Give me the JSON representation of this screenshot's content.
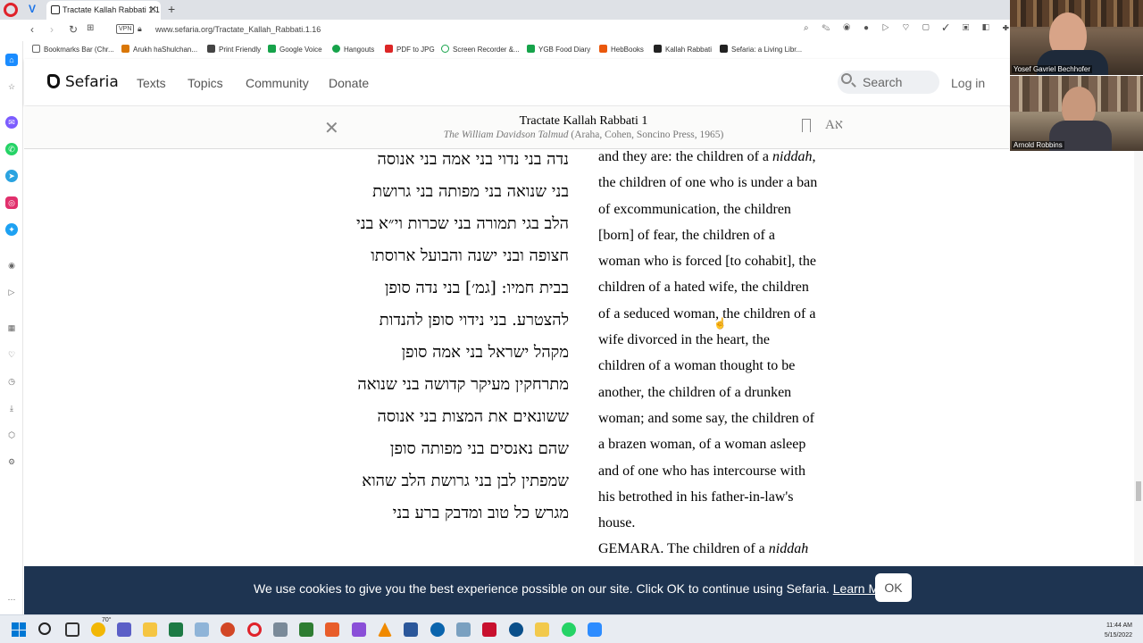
{
  "browser": {
    "tab_title": "Tractate Kallah Rabbati 1:1",
    "url": "www.sefaria.org/Tractate_Kallah_Rabbati.1.16",
    "vpn_label": "VPN",
    "bookmarks": [
      "Bookmarks Bar (Chr...",
      "Arukh haShulchan...",
      "Print Friendly",
      "Google Voice",
      "Hangouts",
      "PDF to JPG",
      "Screen Recorder &...",
      "YGB Food Diary",
      "HebBooks",
      "Kallah Rabbati",
      "Sefaria: a Living Libr..."
    ],
    "bookmark_colors": [
      "#666666",
      "#d97706",
      "#444444",
      "#16a34a",
      "#16a34a",
      "#dc2626",
      "#16a34a",
      "#16a34a",
      "#ea580c",
      "#222222",
      "#222222"
    ]
  },
  "sefaria": {
    "logo": "Sefaria",
    "nav": [
      "Texts",
      "Topics",
      "Community",
      "Donate"
    ],
    "search_placeholder": "Search",
    "login": "Log in"
  },
  "reader": {
    "title": "Tractate Kallah Rabbati 1",
    "subtitle_italic": "The William Davidson Talmud",
    "subtitle_rest": " (Araha, Cohen, Soncino Press, 1965)"
  },
  "hebrew_lines": [
    "נדה בני נדוי בני אמה בני אנוסה",
    "בני שנואה בני מפותה בני גרושת",
    "הלב בגי תמורה בני שכרות וי״א בני",
    "חצופה ובני ישנה והבועל ארוסתו",
    "בבית חמיו: [גמ׳] בני נדה סופן",
    "להצטרע. בני נידוי סופן להנדות",
    "מקהל ישראל בני אמה סופן",
    "מתרחקין מעיקר קדושה בני שנואה",
    "ששונאים את המצות בני אנוסה",
    "שהם נאנסים בני מפותה סופן",
    "שמפתין לבן בני גרושת הלב שהוא",
    "מגרש כל טוב ומדבק ברע בני"
  ],
  "english_lines": [
    "and they are: the children of a niddah,",
    "the children of one who is under a ban",
    "of excommunication, the children",
    "[born] of fear, the children of a",
    "woman who is forced [to cohabit], the",
    "children of a hated wife, the children",
    "of a seduced woman, the children of a",
    "wife divorced in the heart, the",
    "children of a woman thought to be",
    "another, the children of a drunken",
    "woman; and some say, the children of",
    "a brazen woman, of a woman asleep",
    "and of one who has intercourse with",
    "his betrothed in his father-in-law's",
    "house."
  ],
  "english_gemara": {
    "prefix": "GEMARA. The children of a ",
    "italic": "niddah"
  },
  "cookie": {
    "text": "We use cookies to give you the best experience possible on our site. Click OK to continue using Sefaria.",
    "link": "Learn More",
    "ok": "OK"
  },
  "video": {
    "participant1": "Yosef Gavriel Bechhofer",
    "participant2": "Arnold Robbins"
  },
  "taskbar": {
    "time": "11:44 AM",
    "date": "5/15/2022",
    "weather_temp": "70°"
  },
  "colors": {
    "cookie_bg": "#1e3451",
    "reader_header_bg": "#fbfbfa",
    "accent_blue": "#0078d4"
  }
}
